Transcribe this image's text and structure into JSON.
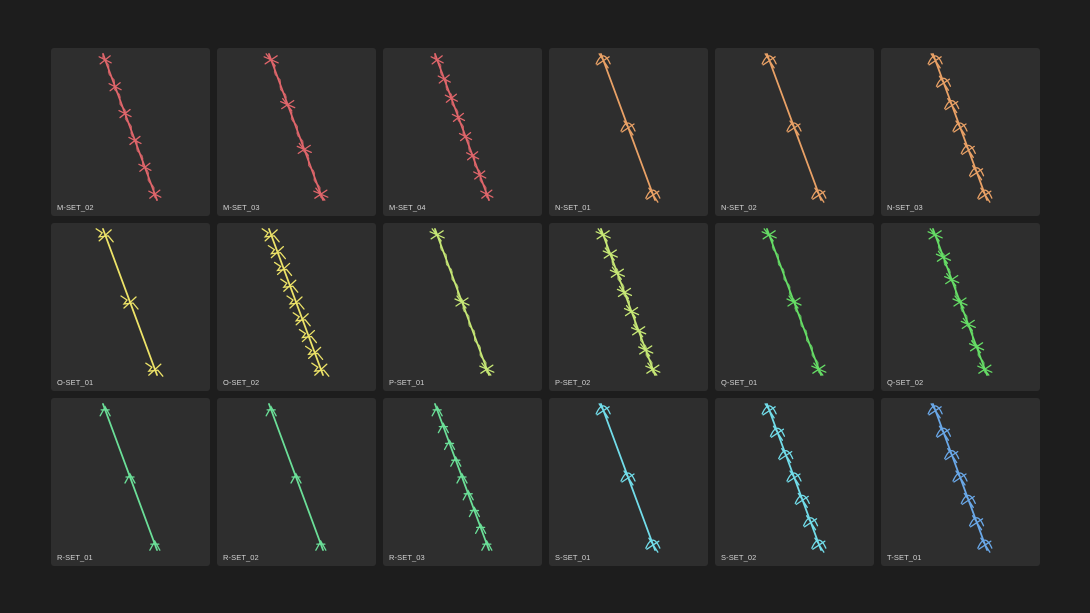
{
  "gallery": {
    "items": [
      {
        "label": "M-SET_02",
        "color": "#e0666b",
        "style": "spike",
        "barbs": 6
      },
      {
        "label": "M-SET_03",
        "color": "#e0666b",
        "style": "coil",
        "barbs": 4
      },
      {
        "label": "M-SET_04",
        "color": "#e0666b",
        "style": "spike",
        "barbs": 8
      },
      {
        "label": "N-SET_01",
        "color": "#e9a166",
        "style": "loop",
        "barbs": 3
      },
      {
        "label": "N-SET_02",
        "color": "#e9a166",
        "style": "loop",
        "barbs": 3
      },
      {
        "label": "N-SET_03",
        "color": "#e9a166",
        "style": "loop",
        "barbs": 7
      },
      {
        "label": "O-SET_01",
        "color": "#ede368",
        "style": "zigzag",
        "barbs": 3
      },
      {
        "label": "O-SET_02",
        "color": "#ede368",
        "style": "zigzag",
        "barbs": 9
      },
      {
        "label": "P-SET_01",
        "color": "#c7e876",
        "style": "coil",
        "barbs": 3
      },
      {
        "label": "P-SET_02",
        "color": "#c7e876",
        "style": "coil",
        "barbs": 8
      },
      {
        "label": "Q-SET_01",
        "color": "#66dd66",
        "style": "coil",
        "barbs": 3
      },
      {
        "label": "Q-SET_02",
        "color": "#66dd66",
        "style": "coil",
        "barbs": 7
      },
      {
        "label": "R-SET_01",
        "color": "#6bdf98",
        "style": "arrow",
        "barbs": 3
      },
      {
        "label": "R-SET_02",
        "color": "#6bdf98",
        "style": "arrow",
        "barbs": 3
      },
      {
        "label": "R-SET_03",
        "color": "#6bdf98",
        "style": "arrow",
        "barbs": 9
      },
      {
        "label": "S-SET_01",
        "color": "#72ddea",
        "style": "loop",
        "barbs": 3
      },
      {
        "label": "S-SET_02",
        "color": "#72ddea",
        "style": "loop",
        "barbs": 7
      },
      {
        "label": "T-SET_01",
        "color": "#6aa8e8",
        "style": "loop",
        "barbs": 7
      }
    ]
  }
}
